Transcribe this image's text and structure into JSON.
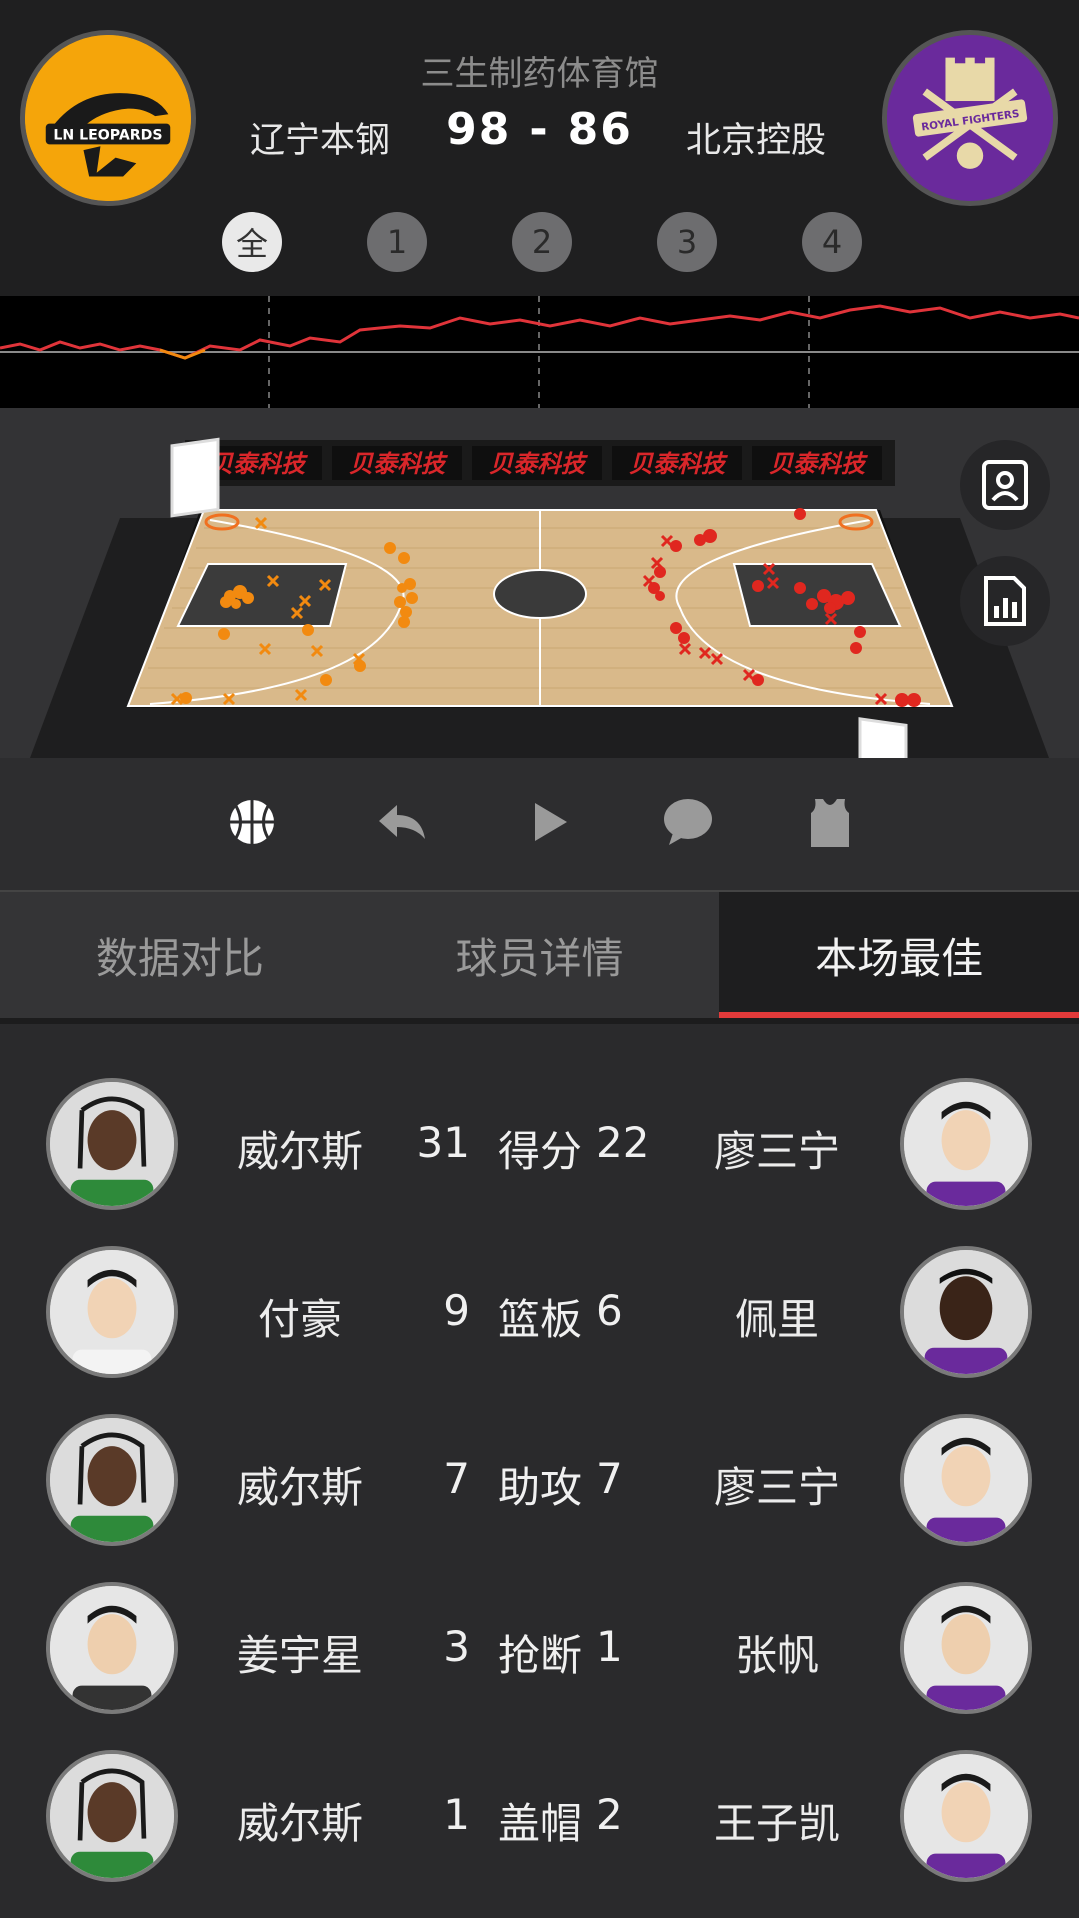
{
  "header": {
    "venue": "三生制药体育馆",
    "home_team": "辽宁本钢",
    "away_team": "北京控股",
    "home_score": "98",
    "away_score": "86",
    "score_separator": "-",
    "home_logo_text": "LN LEOPARDS",
    "away_logo_text": "ROYAL FIGHTERS"
  },
  "periods": [
    "全",
    "1",
    "2",
    "3",
    "4"
  ],
  "active_period": "全",
  "court": {
    "sponsor_text": "贝泰科技",
    "sponsor_color": "#d9262a",
    "home_shot_color": "#f28a10",
    "away_shot_color": "#e0271f"
  },
  "side_buttons": [
    "player-card-icon",
    "report-chart-icon"
  ],
  "toolbar": [
    "basketball-icon",
    "replay-icon",
    "play-icon",
    "comment-icon",
    "jersey-icon"
  ],
  "tabs": [
    {
      "label": "数据对比",
      "active": false
    },
    {
      "label": "球员详情",
      "active": false
    },
    {
      "label": "本场最佳",
      "active": true
    }
  ],
  "best": [
    {
      "left_name": "威尔斯",
      "left_value": "31",
      "label": "得分",
      "right_value": "22",
      "right_name": "廖三宁"
    },
    {
      "left_name": "付豪",
      "left_value": "9",
      "label": "篮板",
      "right_value": "6",
      "right_name": "佩里"
    },
    {
      "left_name": "威尔斯",
      "left_value": "7",
      "label": "助攻",
      "right_value": "7",
      "right_name": "廖三宁"
    },
    {
      "left_name": "姜宇星",
      "left_value": "3",
      "label": "抢断",
      "right_value": "1",
      "right_name": "张帆"
    },
    {
      "left_name": "威尔斯",
      "left_value": "1",
      "label": "盖帽",
      "right_value": "2",
      "right_name": "王子凯"
    }
  ],
  "colors": {
    "accent": "#e23a3a",
    "home_logo_bg": "#f5a50a",
    "away_logo_bg": "#6a2a9c"
  }
}
